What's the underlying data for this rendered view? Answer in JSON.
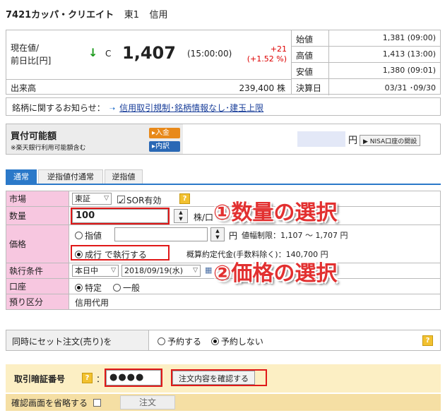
{
  "header": {
    "name": "7421カッパ・クリエイト",
    "market": "東1",
    "type": "信用"
  },
  "quote": {
    "label_line1": "現在値/",
    "label_line2": "前日比[円]",
    "arrow": "↓",
    "c_mark": "C",
    "price": "1,407",
    "time": "(15:00:00)",
    "change": "+21",
    "change_pct": "(+1.52 %)",
    "volume_label": "出来高",
    "volume_value": "239,400 株",
    "rows": [
      {
        "label": "始値",
        "value": "1,381 (09:00)"
      },
      {
        "label": "高値",
        "value": "1,413 (13:00)"
      },
      {
        "label": "安値",
        "value": "1,380 (09:01)"
      },
      {
        "label": "決算日",
        "value": "03/31 ･09/30"
      }
    ]
  },
  "notice": {
    "label": "銘柄に関するお知らせ：",
    "arrow": "➝",
    "link": "信用取引規制･銘柄情報なし･建玉上限"
  },
  "buying": {
    "title": "買付可能額",
    "note": "※楽天銀行利用可能額含む",
    "deposit": "▸入金",
    "withdraw": "▸内訳",
    "unit": "円",
    "nisa": "▶ NISA口座の開設"
  },
  "tabs": [
    {
      "label": "通常"
    },
    {
      "label": "逆指値付通常"
    },
    {
      "label": "逆指値"
    }
  ],
  "form": {
    "market": {
      "label": "市場",
      "value": "東証",
      "sor": "SOR有効",
      "help": "?"
    },
    "qty": {
      "label": "数量",
      "value": "100",
      "unit": "株/口"
    },
    "price": {
      "label": "価格",
      "limit": "指値",
      "unit": "円",
      "range": "値幅制限：1,107 ～ 1,707 円",
      "market_order": "成行 で執行する",
      "estimate": "概算約定代金(手数料除く)：140,700 円"
    },
    "cond": {
      "label": "執行条件",
      "value": "本日中",
      "date": "2018/09/19(水)"
    },
    "account": {
      "label": "口座",
      "opt1": "特定",
      "opt2": "一般"
    },
    "deposit": {
      "label": "預り区分",
      "value": "信用代用"
    }
  },
  "overlay": {
    "qty_text": "①数量の選択",
    "price_text": "②価格の選択"
  },
  "set_order": {
    "label": "同時にセット注文(売り)を",
    "opt_yes": "予約する",
    "opt_no": "予約しない",
    "help": "?"
  },
  "pin": {
    "label": "取引暗証番号",
    "help": "?",
    "colon": "：",
    "value": "●●●●",
    "confirm": "注文内容を確認する"
  },
  "footer": {
    "skip": "確認画面を省略する",
    "order": "注文"
  }
}
